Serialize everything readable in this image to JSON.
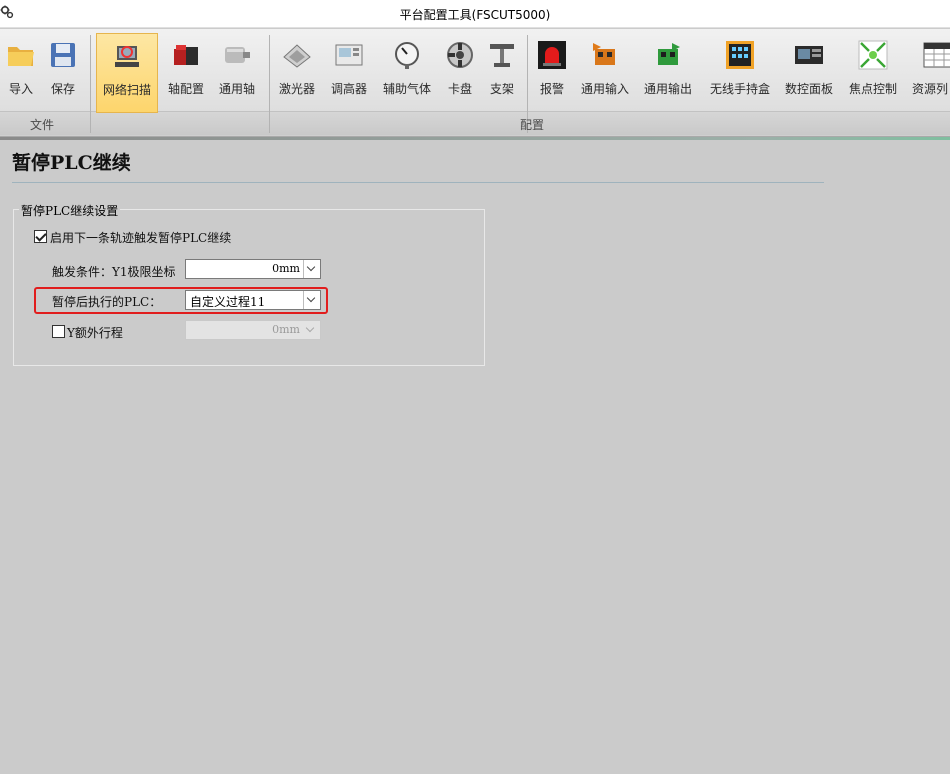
{
  "window": {
    "title": "平台配置工具(FSCUT5000)",
    "icon": "gear-icon"
  },
  "ribbon": {
    "buttons": [
      {
        "label": "导入",
        "icon": "folder-open-icon"
      },
      {
        "label": "保存",
        "icon": "floppy-disk-icon"
      },
      {
        "label": "网络扫描",
        "icon": "network-scan-icon",
        "active": true
      },
      {
        "label": "轴配置",
        "icon": "servo-motor-icon"
      },
      {
        "label": "通用轴",
        "icon": "motor-icon"
      },
      {
        "label": "激光器",
        "icon": "laser-icon"
      },
      {
        "label": "调高器",
        "icon": "height-controller-icon"
      },
      {
        "label": "辅助气体",
        "icon": "gauge-icon"
      },
      {
        "label": "卡盘",
        "icon": "chuck-icon"
      },
      {
        "label": "支架",
        "icon": "support-icon"
      },
      {
        "label": "报警",
        "icon": "alarm-light-icon"
      },
      {
        "label": "通用输入",
        "icon": "input-terminal-icon"
      },
      {
        "label": "通用输出",
        "icon": "output-terminal-icon"
      },
      {
        "label": "无线手持盒",
        "icon": "wireless-handbox-icon"
      },
      {
        "label": "数控面板",
        "icon": "cnc-panel-icon"
      },
      {
        "label": "焦点控制",
        "icon": "focus-control-icon"
      },
      {
        "label": "资源列",
        "icon": "resource-list-icon"
      }
    ],
    "groups": {
      "file": "文件",
      "config": "配置"
    }
  },
  "page": {
    "title": "暂停PLC继续",
    "groupbox_title": "暂停PLC继续设置",
    "enable_checkbox": {
      "label": "启用下一条轨迹触发暂停PLC继续",
      "checked": true
    },
    "trigger": {
      "label": "触发条件：Y1极限坐标",
      "value": "0mm"
    },
    "plc_after_pause": {
      "label": "暂停后执行的PLC：",
      "value": "自定义过程11"
    },
    "y_extra": {
      "label": "Y额外行程",
      "checked": false,
      "value": "0mm",
      "disabled": true
    }
  },
  "colors": {
    "highlight": "#e11d1d",
    "active_button": "#fdd56c",
    "background": "#cbcbcb"
  }
}
